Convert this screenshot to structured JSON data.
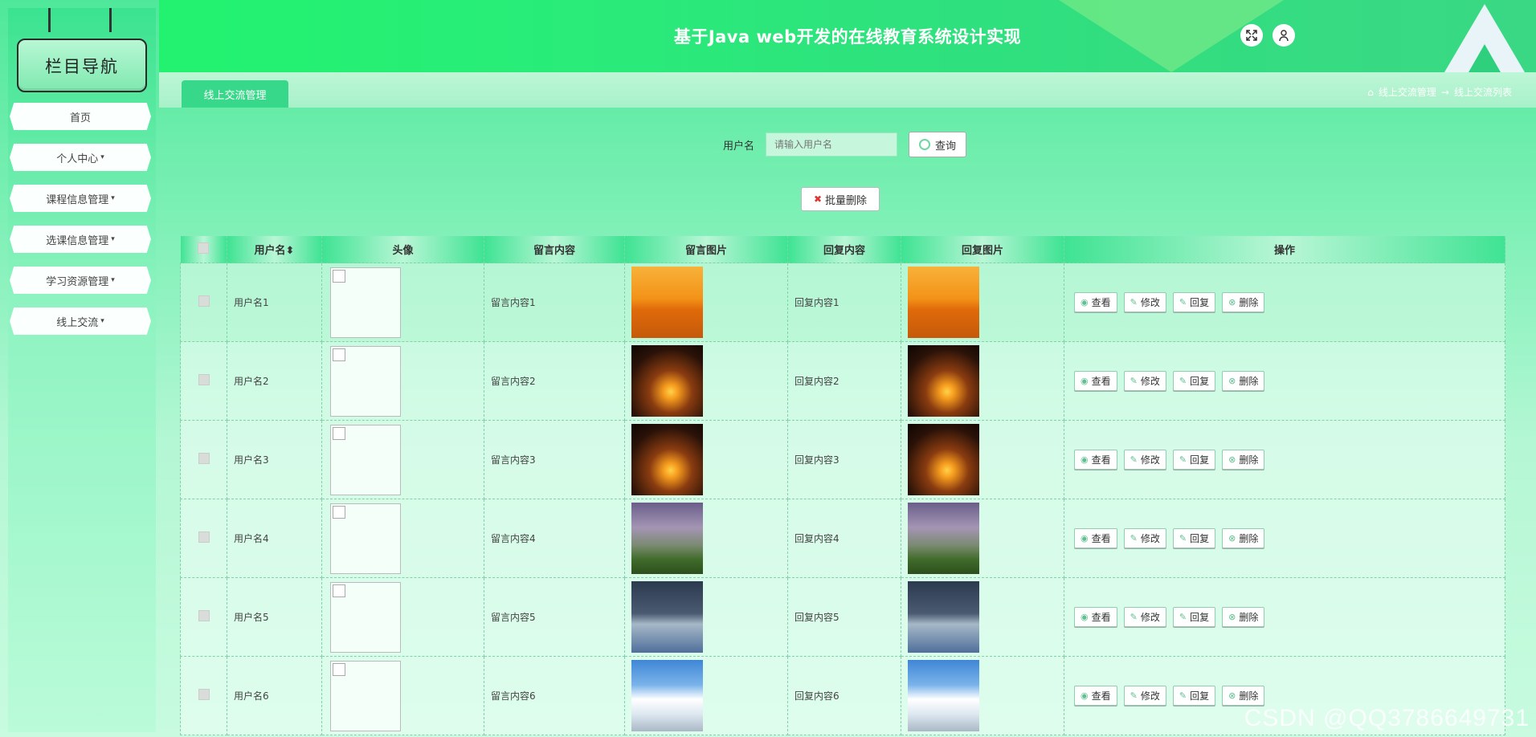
{
  "app": {
    "title": "基于Java web开发的在线教育系统设计实现"
  },
  "sidebar": {
    "badge": "栏目导航",
    "items": [
      {
        "label": "首页",
        "caret": ""
      },
      {
        "label": "个人中心",
        "caret": "▾"
      },
      {
        "label": "课程信息管理",
        "caret": "▾"
      },
      {
        "label": "选课信息管理",
        "caret": "▾"
      },
      {
        "label": "学习资源管理",
        "caret": "▾"
      },
      {
        "label": "线上交流",
        "caret": "▾"
      }
    ]
  },
  "tabs": {
    "active": "线上交流管理"
  },
  "breadcrumb": {
    "home_icon": "⌂",
    "part1": "线上交流管理",
    "sep": "→",
    "part2": "线上交流列表"
  },
  "search": {
    "label": "用户名",
    "placeholder": "请输入用户名",
    "button": "查询"
  },
  "batch_delete": {
    "icon": "✖",
    "label": "批量删除"
  },
  "table": {
    "headers": {
      "username": "用户名",
      "sort_icon": "⬍",
      "avatar": "头像",
      "message": "留言内容",
      "message_image": "留言图片",
      "reply": "回复内容",
      "reply_image": "回复图片",
      "actions": "操作"
    },
    "rows": [
      {
        "username": "用户名1",
        "message": "留言内容1",
        "reply": "回复内容1",
        "image": "sunset"
      },
      {
        "username": "用户名2",
        "message": "留言内容2",
        "reply": "回复内容2",
        "image": "palm"
      },
      {
        "username": "用户名3",
        "message": "留言内容3",
        "reply": "回复内容3",
        "image": "palm"
      },
      {
        "username": "用户名4",
        "message": "留言内容4",
        "reply": "回复内容4",
        "image": "mountain"
      },
      {
        "username": "用户名5",
        "message": "留言内容5",
        "reply": "回复内容5",
        "image": "lake"
      },
      {
        "username": "用户名6",
        "message": "留言内容6",
        "reply": "回复内容6",
        "image": "snow"
      }
    ],
    "actions": {
      "view": "查看",
      "edit": "修改",
      "reply": "回复",
      "delete": "删除"
    }
  },
  "watermark": "CSDN @QQ3786649731",
  "colors": {
    "accent": "#38d88a",
    "header": "#29ec79"
  }
}
